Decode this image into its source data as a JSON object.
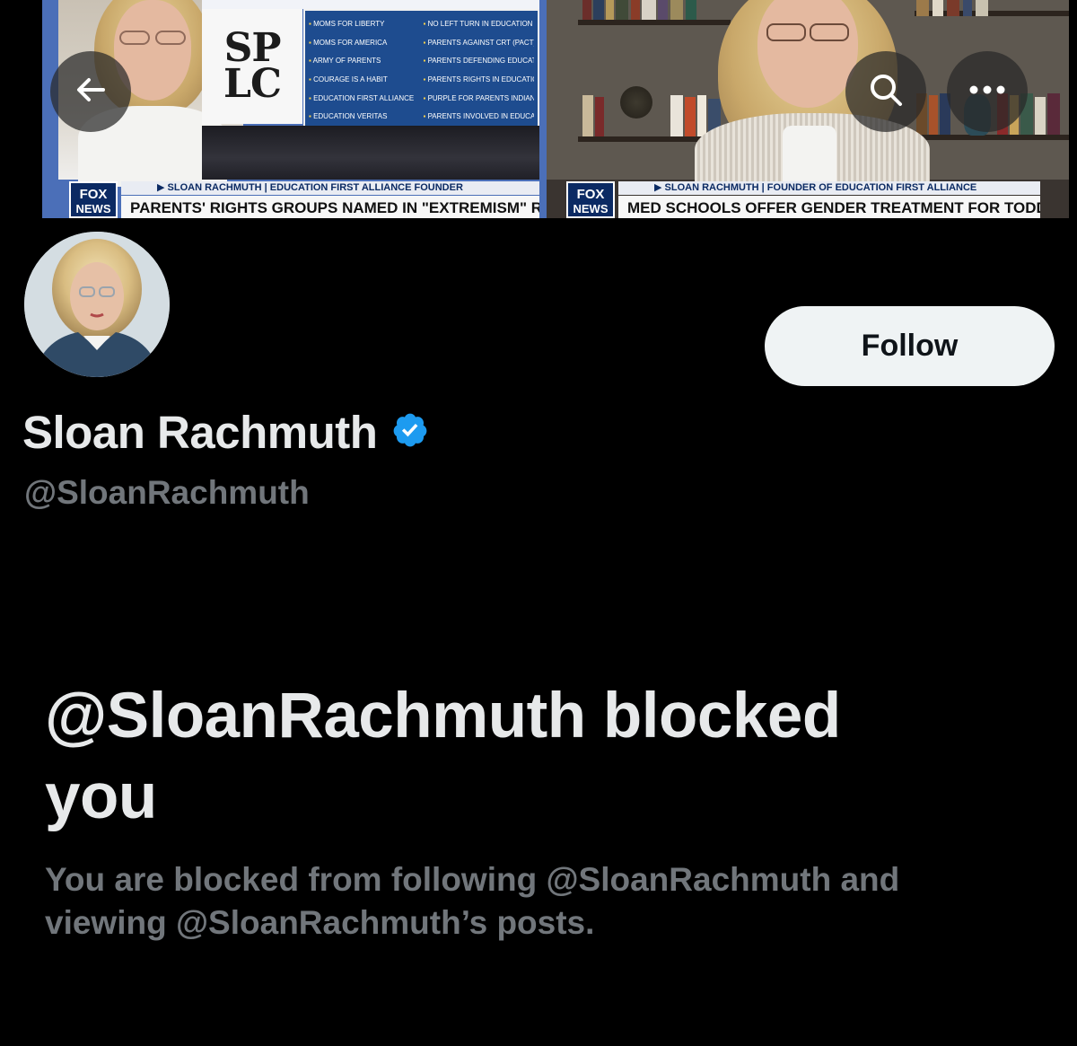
{
  "banner": {
    "left_panel": {
      "logo_text": "SP\nLC",
      "groups": [
        "MOMS FOR LIBERTY",
        "NO LEFT TURN IN EDUCATION",
        "MOMS FOR AMERICA",
        "PARENTS AGAINST CRT (PACT)",
        "ARMY OF PARENTS",
        "PARENTS DEFENDING EDUCATION",
        "COURAGE IS A HABIT",
        "PARENTS RIGHTS IN EDUCATION",
        "EDUCATION FIRST ALLIANCE",
        "PURPLE FOR PARENTS INDIANA",
        "EDUCATION VERITAS",
        "PARENTS INVOLVED IN EDUCATION"
      ],
      "network_top": "FOX",
      "network_bottom": "NEWS",
      "lower_third_name": "▶ SLOAN RACHMUTH | EDUCATION FIRST ALLIANCE FOUNDER",
      "lower_third_headline": "PARENTS' RIGHTS GROUPS NAMED IN \"EXTREMISM\" REPORT"
    },
    "right_panel": {
      "network_top": "FOX",
      "network_bottom": "NEWS",
      "lower_third_name": "▶ SLOAN RACHMUTH | FOUNDER OF EDUCATION FIRST ALLIANCE",
      "lower_third_headline": "MED SCHOOLS OFFER GENDER TREATMENT FOR TODDLERS"
    },
    "icons": {
      "back": "arrow-left-icon",
      "search": "search-icon",
      "more": "more-horizontal-icon"
    }
  },
  "profile": {
    "display_name": "Sloan Rachmuth",
    "verified_icon": "verified-badge-icon",
    "verified_color": "#1d9bf0",
    "handle": "@SloanRachmuth",
    "follow_label": "Follow"
  },
  "blocked": {
    "title": "@SloanRachmuth blocked you",
    "description": "You are blocked from following @SloanRachmuth and viewing @SloanRachmuth’s posts."
  }
}
